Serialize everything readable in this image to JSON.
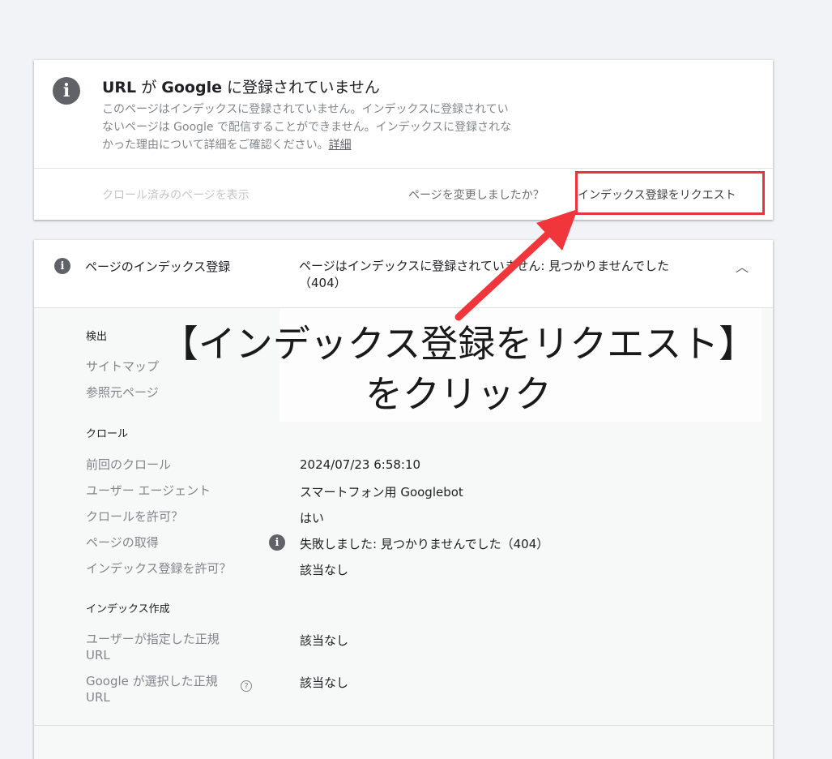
{
  "status": {
    "title_part1": "URL",
    "title_part2": " が ",
    "title_part3": "Google",
    "title_part4": " に登録されていません",
    "description_line1": "このページはインデックスに登録されていません。インデックスに登録されてい",
    "description_line2": "ないページは Google で配信することができません。インデックスに登録されな",
    "description_line3": "かった理由について詳細をご確認ください。",
    "details_link": "詳細",
    "crawled_page_link": "クロール済みのページを表示",
    "changed_question": "ページを変更しましたか？",
    "request_indexing_button": "インデックス登録をリクエスト",
    "highlight_color": "#e8343a"
  },
  "coverage": {
    "label": "ページのインデックス登録",
    "value": "ページはインデックスに登録されていません: 見つかりませんでした（404）",
    "discovery": {
      "heading": "検出",
      "rows": [
        {
          "label": "サイトマップ"
        },
        {
          "label": "参照元ページ"
        }
      ]
    },
    "crawl": {
      "heading": "クロール",
      "rows": [
        {
          "label": "前回のクロール",
          "value": "2024/07/23 6:58:10"
        },
        {
          "label": "ユーザー エージェント",
          "value": "スマートフォン用 Googlebot"
        },
        {
          "label": "クロールを許可？",
          "value": "はい"
        },
        {
          "label": "ページの取得",
          "value": "失敗しました: 見つかりませんでした（404）"
        },
        {
          "label": "インデックス登録を許可？",
          "value": "該当なし"
        }
      ]
    },
    "indexing": {
      "heading": "インデックス作成",
      "rows": [
        {
          "label": "ユーザーが指定した正規 URL",
          "value": "該当なし"
        },
        {
          "label": "Google が選択した正規 URL",
          "value": "該当なし"
        }
      ]
    }
  },
  "annotation": {
    "line1": "【インデックス登録をリクエスト】",
    "line2": "をクリック",
    "arrow_color": "#f0353b"
  },
  "icons": {
    "info": "info-icon",
    "expand": "chevron-up-icon",
    "help": "help-icon"
  }
}
